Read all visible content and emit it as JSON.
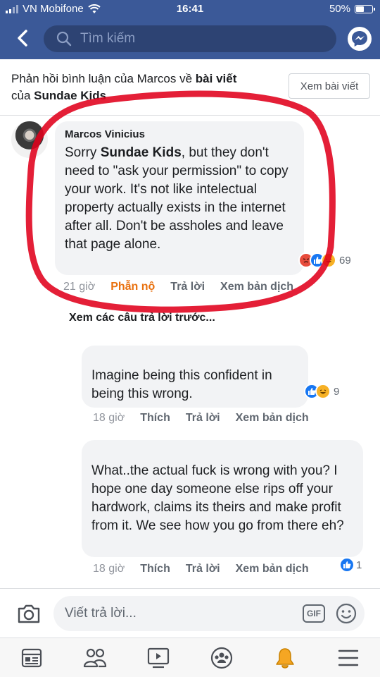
{
  "status_bar": {
    "carrier": "VN Mobifone",
    "time": "16:41",
    "battery": "50%",
    "battery_level": 0.5
  },
  "header": {
    "search_placeholder": "Tìm kiếm"
  },
  "reply_header": {
    "text_1": "Phản hồi bình luận của Marcos về ",
    "post_link": "bài viết",
    "text_2": "của ",
    "page_name": "Sundae Kids",
    "view_post_button": "Xem bài viết"
  },
  "comments": [
    {
      "author": "Marcos Vinicius",
      "text_prefix": "Sorry ",
      "mention": "Sundae Kids",
      "text_rest": ", but they don't need to \"ask your permission\" to copy your work. It's not like intelectual property actually exists in the internet after all. Don't be assholes and leave that page alone.",
      "reaction_count": "69",
      "time": "21 giờ",
      "reaction_label": "Phẫn nộ",
      "reply_label": "Trả lời",
      "translate_label": "Xem bản dịch"
    },
    {
      "text": "Imagine being this confident in being this wrong.",
      "reaction_count": "9",
      "time": "18 giờ",
      "like_label": "Thích",
      "reply_label": "Trả lời",
      "translate_label": "Xem bản dịch"
    },
    {
      "text": "What..the actual fuck is wrong with you? I hope one day someone else rips off your hardwork, claims its theirs and make profit from it. We see how you go from there eh?",
      "reaction_count": "1",
      "time": "18 giờ",
      "like_label": "Thích",
      "reply_label": "Trả lời",
      "translate_label": "Xem bản dịch"
    }
  ],
  "previous_replies": "Xem các câu trả lời trước...",
  "composer": {
    "placeholder": "Viết trả lời...",
    "gif_label": "GIF"
  },
  "tabs": [
    "news-feed",
    "friends",
    "watch",
    "groups",
    "notifications",
    "menu"
  ]
}
